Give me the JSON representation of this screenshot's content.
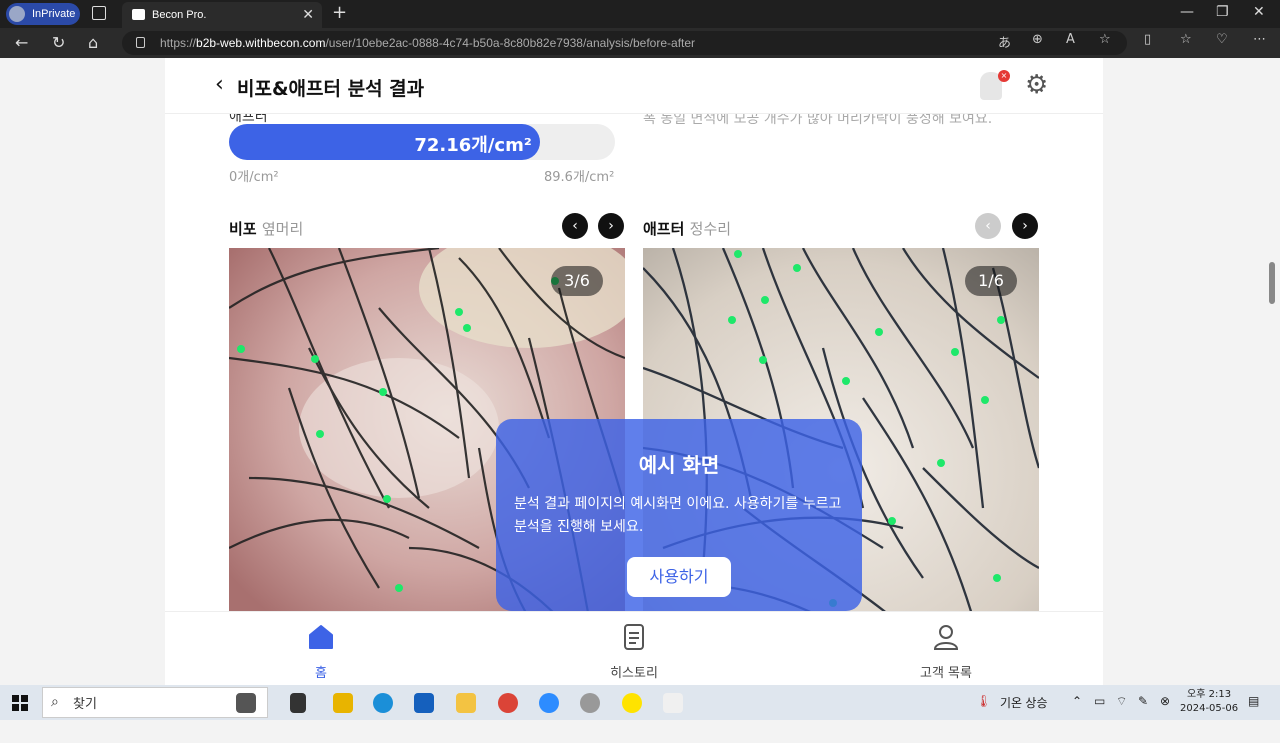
{
  "browser": {
    "profile_label": "InPrivate",
    "tab_title": "Becon Pro.",
    "url_prefix": "https://",
    "url_host": "b2b-web.withbecon.com",
    "url_path": "/user/10ebe2ac-0888-4c74-b50a-8c80b82e7938/analysis/before-after"
  },
  "header": {
    "title": "비포&애프터 분석 결과",
    "back_icon": "chevron-left-icon",
    "notification_badge": "×",
    "settings_icon": "gear-icon"
  },
  "density": {
    "label": "애프터",
    "value_text": "72.16개/cm²",
    "fill_fraction": 0.805,
    "min_label": "0개/cm²",
    "max_label": "89.6개/cm²",
    "note": "폭 동일 면적에 모공 개수가 많아 머리카락이 풍성해 보여요."
  },
  "before": {
    "label": "비포",
    "sub": "옆머리",
    "counter": "3/6"
  },
  "after": {
    "label": "애프터",
    "sub": "정수리",
    "counter": "1/6"
  },
  "overlay": {
    "title": "예시 화면",
    "text": "분석 결과 페이지의 예시화면 이에요. 사용하기를 누르고 분석을 진행해 보세요.",
    "button": "사용하기"
  },
  "bottom_nav": [
    {
      "label": "홈",
      "icon": "home-icon",
      "active": true
    },
    {
      "label": "히스토리",
      "icon": "document-icon",
      "active": false
    },
    {
      "label": "고객 목록",
      "icon": "person-icon",
      "active": false
    }
  ],
  "taskbar": {
    "search_placeholder": "찾기",
    "weather": "기온 상승",
    "time": "오후 2:13",
    "date": "2024-05-06"
  }
}
